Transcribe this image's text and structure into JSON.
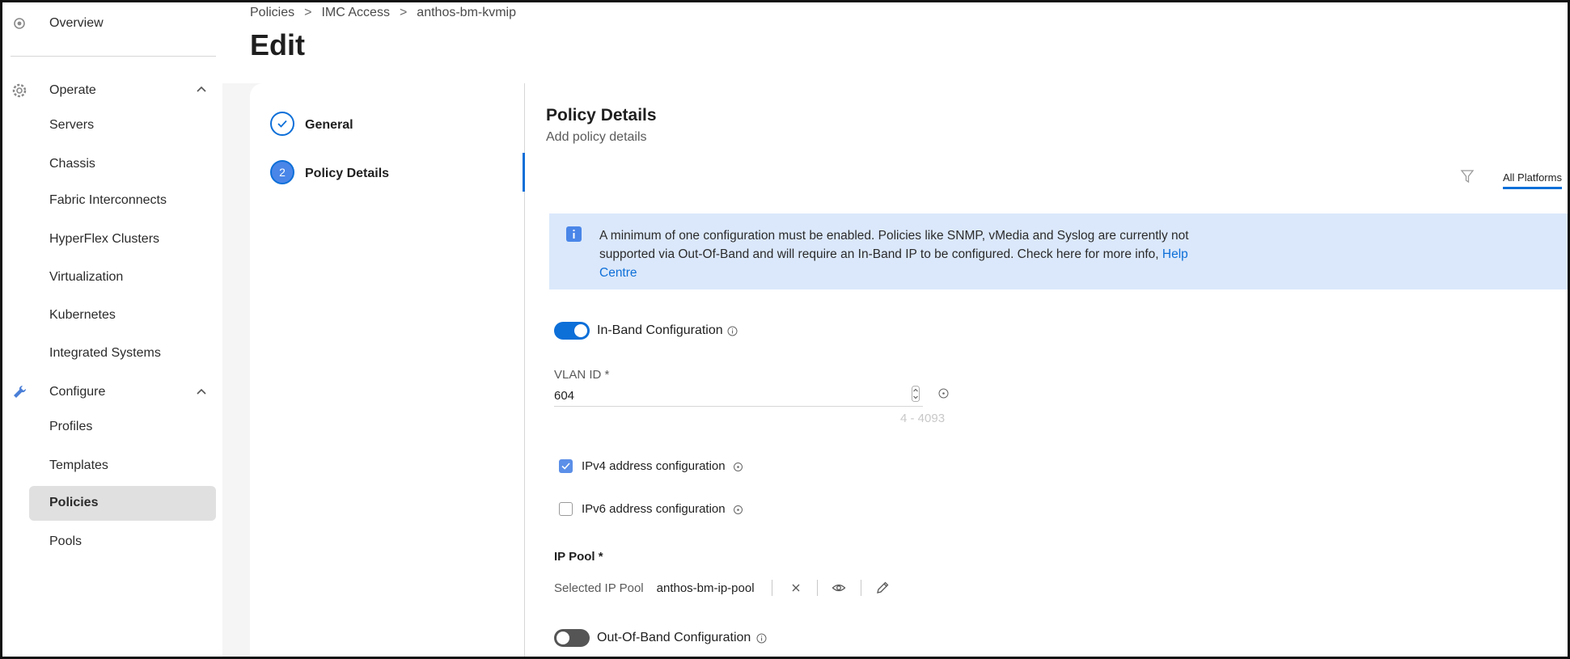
{
  "sidebar": {
    "overview_label": "Overview",
    "operate": {
      "label": "Operate",
      "items": [
        "Servers",
        "Chassis",
        "Fabric Interconnects",
        "HyperFlex Clusters",
        "Virtualization",
        "Kubernetes",
        "Integrated Systems"
      ]
    },
    "configure": {
      "label": "Configure",
      "items": [
        "Profiles",
        "Templates",
        "Policies",
        "Pools"
      ]
    },
    "active_item": "Policies"
  },
  "breadcrumb": [
    "Policies",
    "IMC Access",
    "anthos-bm-kvmip"
  ],
  "breadcrumb_sep": ">",
  "page_title": "Edit",
  "steps": [
    {
      "number": "",
      "label": "General",
      "state": "complete"
    },
    {
      "number": "2",
      "label": "Policy Details",
      "state": "active"
    }
  ],
  "section": {
    "title": "Policy Details",
    "subtitle": "Add policy details"
  },
  "platform_tab": "All Platforms",
  "info_banner": {
    "text": "A minimum of one configuration must be enabled. Policies like SNMP, vMedia and Syslog are currently not supported via Out-Of-Band and will require an In-Band IP to be configured. Check here for more info,",
    "link": "Help Centre"
  },
  "inband": {
    "label": "In-Band Configuration",
    "enabled": true
  },
  "vlan": {
    "label": "VLAN ID *",
    "value": "604",
    "range": "4 - 4093"
  },
  "ipv4": {
    "label": "IPv4 address configuration",
    "checked": true
  },
  "ipv6": {
    "label": "IPv6 address configuration",
    "checked": false
  },
  "ip_pool": {
    "title": "IP Pool *",
    "key": "Selected IP Pool",
    "value": "anthos-bm-ip-pool"
  },
  "outofband": {
    "label": "Out-Of-Band Configuration",
    "enabled": false
  },
  "colors": {
    "accent": "#0d6fd8",
    "banner": "#dbe8fb",
    "active_nav": "#e0e0e0"
  }
}
